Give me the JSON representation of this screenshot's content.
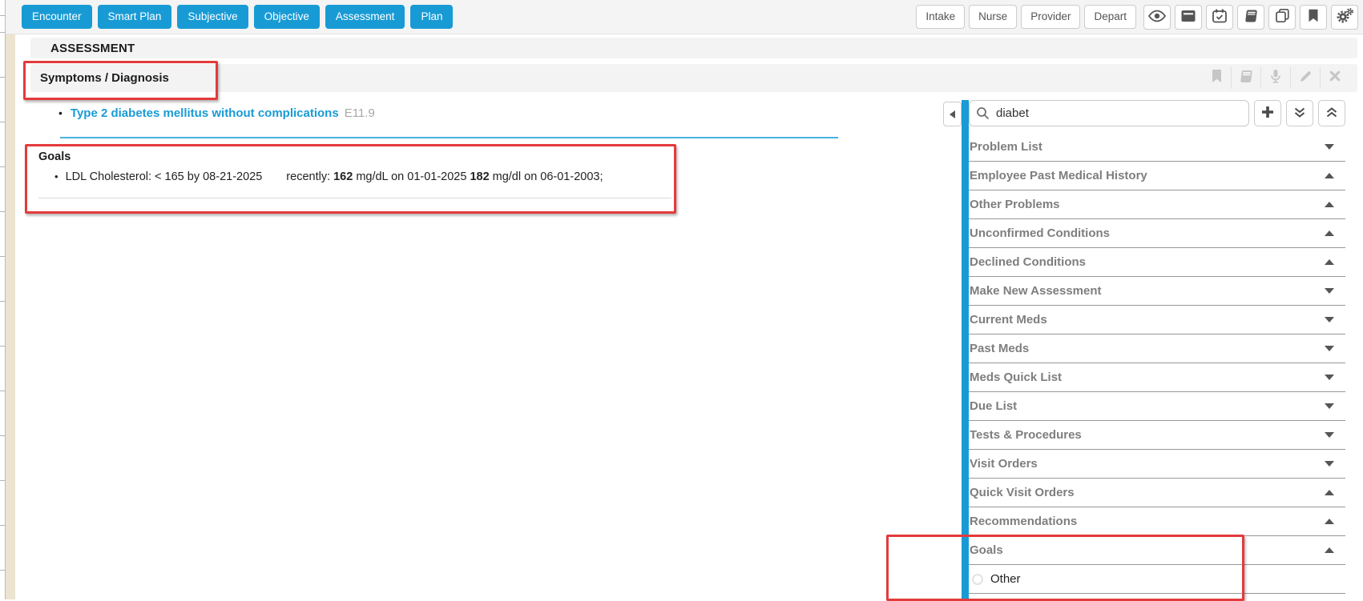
{
  "toolbar": {
    "nav_buttons": [
      "Encounter",
      "Smart Plan",
      "Subjective",
      "Objective",
      "Assessment",
      "Plan"
    ],
    "stage_buttons": [
      "Intake",
      "Nurse",
      "Provider",
      "Depart"
    ],
    "icon_buttons": [
      "eye-icon",
      "archive-icon",
      "calendar-check-icon",
      "book-icon",
      "copy-icon",
      "bookmark-icon",
      "gears-icon"
    ]
  },
  "page": {
    "title": "ASSESSMENT"
  },
  "section": {
    "title": "Symptoms / Diagnosis",
    "action_icons": [
      "bookmark-icon",
      "book-icon",
      "microphone-icon",
      "pencil-icon",
      "close-icon"
    ],
    "diagnosis": {
      "bullet": "•",
      "name": "Type 2 diabetes mellitus without complications",
      "code": "E11.9"
    },
    "goals": {
      "heading": "Goals",
      "item": {
        "bullet": "•",
        "lead": "LDL Cholesterol: < 165 by 08-21-2025",
        "recently_label": "recently:",
        "value1": "162",
        "mid1": "mg/dL on 01-01-2025",
        "value2": "182",
        "tail": "mg/dl on 06-01-2003;"
      }
    }
  },
  "sidebar": {
    "search": {
      "value": "diabet",
      "icon": "search-icon"
    },
    "buttons": [
      "add",
      "expand-all",
      "collapse-all"
    ],
    "items": [
      {
        "label": "Problem List",
        "caret": "down"
      },
      {
        "label": "Employee Past Medical History",
        "caret": "up"
      },
      {
        "label": "Other Problems",
        "caret": "up"
      },
      {
        "label": "Unconfirmed Conditions",
        "caret": "up"
      },
      {
        "label": "Declined Conditions",
        "caret": "up"
      },
      {
        "label": "Make New Assessment",
        "caret": "down"
      },
      {
        "label": "Current Meds",
        "caret": "down"
      },
      {
        "label": "Past Meds",
        "caret": "down"
      },
      {
        "label": "Meds Quick List",
        "caret": "down"
      },
      {
        "label": "Due List",
        "caret": "down"
      },
      {
        "label": "Tests & Procedures",
        "caret": "down"
      },
      {
        "label": "Visit Orders",
        "caret": "down"
      },
      {
        "label": "Quick Visit Orders",
        "caret": "up"
      },
      {
        "label": "Recommendations",
        "caret": "up"
      },
      {
        "label": "Goals",
        "caret": "up"
      }
    ],
    "goal_option": {
      "label": "Other",
      "selected": false
    }
  },
  "colors": {
    "accent_blue": "#189bd5",
    "annotation_red": "#e43a3c",
    "rail_beige": "#ece4d1"
  }
}
